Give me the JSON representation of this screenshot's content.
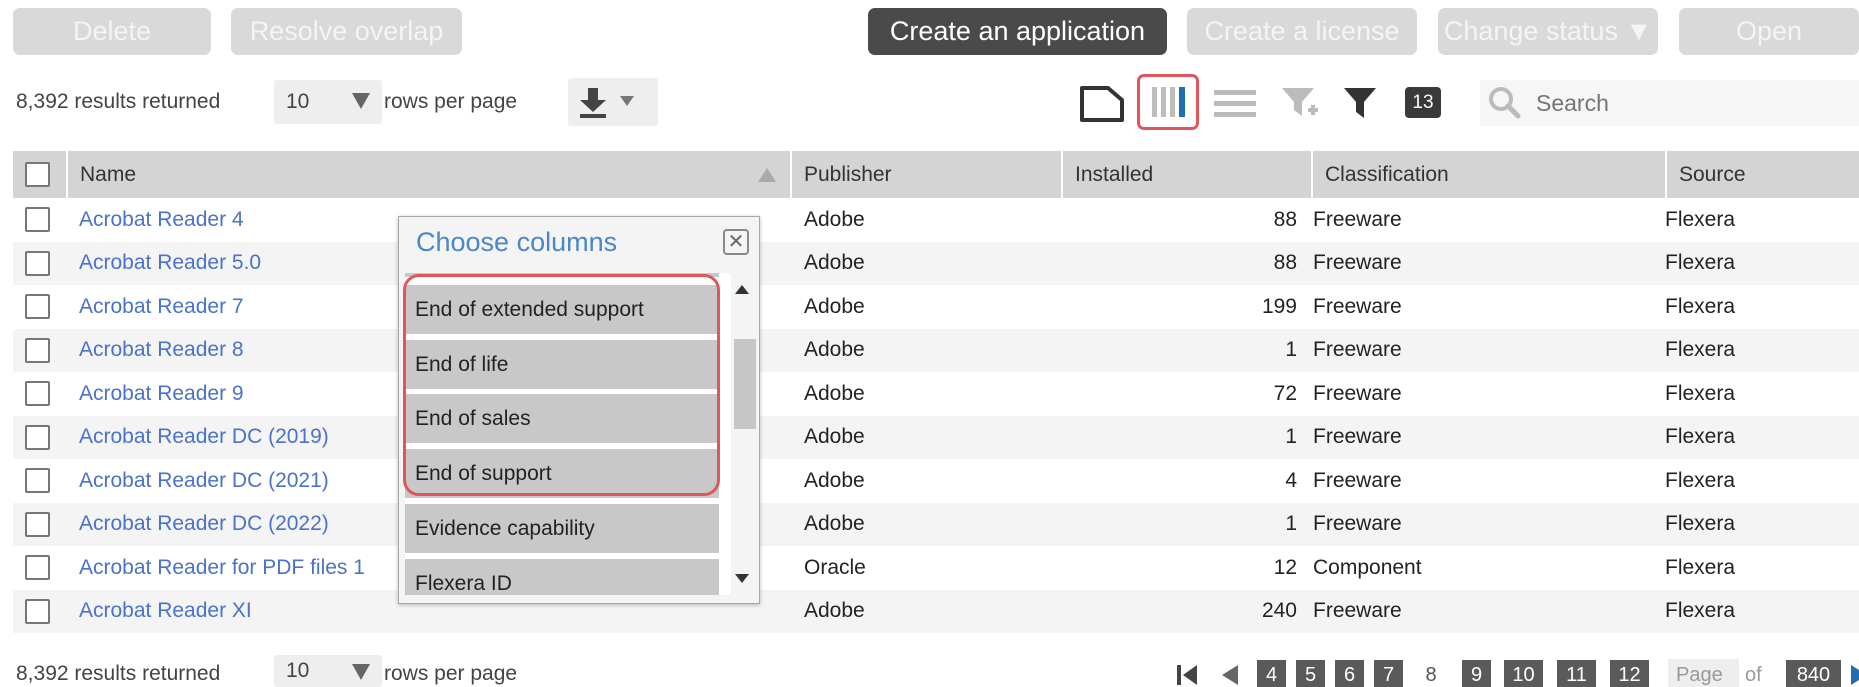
{
  "toolbar": {
    "delete_label": "Delete",
    "resolve_overlap_label": "Resolve overlap",
    "create_application_label": "Create an application",
    "create_license_label": "Create a license",
    "change_status_label": "Change status ▼",
    "open_label": "Open"
  },
  "top_info": {
    "results_text": "8,392 results returned",
    "rows_value": "10",
    "rows_per_page_label": "rows per page"
  },
  "filter_count": "13",
  "search": {
    "placeholder": "Search"
  },
  "columns": {
    "name": "Name",
    "publisher": "Publisher",
    "installed": "Installed",
    "classification": "Classification",
    "source": "Source"
  },
  "rows": [
    {
      "name": "Acrobat Reader 4",
      "publisher": "Adobe",
      "installed": "88",
      "classification": "Freeware",
      "source": "Flexera"
    },
    {
      "name": "Acrobat Reader 5.0",
      "publisher": "Adobe",
      "installed": "88",
      "classification": "Freeware",
      "source": "Flexera"
    },
    {
      "name": "Acrobat Reader 7",
      "publisher": "Adobe",
      "installed": "199",
      "classification": "Freeware",
      "source": "Flexera"
    },
    {
      "name": "Acrobat Reader 8",
      "publisher": "Adobe",
      "installed": "1",
      "classification": "Freeware",
      "source": "Flexera"
    },
    {
      "name": "Acrobat Reader 9",
      "publisher": "Adobe",
      "installed": "72",
      "classification": "Freeware",
      "source": "Flexera"
    },
    {
      "name": "Acrobat Reader DC (2019)",
      "publisher": "Adobe",
      "installed": "1",
      "classification": "Freeware",
      "source": "Flexera"
    },
    {
      "name": "Acrobat Reader DC (2021)",
      "publisher": "Adobe",
      "installed": "4",
      "classification": "Freeware",
      "source": "Flexera"
    },
    {
      "name": "Acrobat Reader DC (2022)",
      "publisher": "Adobe",
      "installed": "1",
      "classification": "Freeware",
      "source": "Flexera"
    },
    {
      "name": "Acrobat Reader for PDF files 1",
      "publisher": "Oracle",
      "installed": "12",
      "classification": "Component",
      "source": "Flexera"
    },
    {
      "name": "Acrobat Reader XI",
      "publisher": "Adobe",
      "installed": "240",
      "classification": "Freeware",
      "source": "Flexera"
    }
  ],
  "choose_columns": {
    "title": "Choose columns",
    "close_glyph": "✕",
    "items": [
      "End of extended support",
      "End of life",
      "End of sales",
      "End of support",
      "Evidence capability",
      "Flexera ID"
    ]
  },
  "bottom_info": {
    "results_text": "8,392 results returned",
    "rows_value": "10",
    "rows_per_page_label": "rows per page"
  },
  "pagination": {
    "pages": [
      "4",
      "5",
      "6",
      "7",
      "8",
      "9",
      "10",
      "11",
      "12"
    ],
    "current": "8",
    "page_label": "Page",
    "of_label": "of",
    "total_pages": "840"
  },
  "colors": {
    "link": "#4a72c8",
    "highlight": "#e0565b",
    "primary_button": "#4a4a4a",
    "disabled_button": "#d9d9d9",
    "column_chooser_icon": "#1f6fb2"
  },
  "icons": {
    "export": "download-icon",
    "bookmark": "bookmark-icon",
    "columns": "columns-icon",
    "group": "group-by-icon",
    "add_filter": "add-filter-icon",
    "filter": "filter-icon",
    "search": "search-icon",
    "first": "first-page-icon",
    "prev": "previous-page-icon",
    "next": "next-page-icon"
  }
}
